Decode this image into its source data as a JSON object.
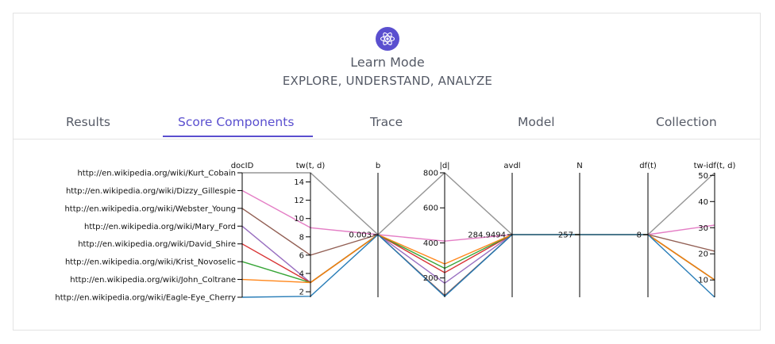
{
  "header": {
    "logo_icon": "atom-icon",
    "title": "Learn Mode",
    "subtitle": "EXPLORE, UNDERSTAND, ANALYZE"
  },
  "tabs": [
    {
      "label": "Results",
      "active": false
    },
    {
      "label": "Score Components",
      "active": true
    },
    {
      "label": "Trace",
      "active": false
    },
    {
      "label": "Model",
      "active": false
    },
    {
      "label": "Collection",
      "active": false
    }
  ],
  "colors": {
    "accent": "#5a4fcf",
    "text": "#555a66"
  },
  "chart_data": {
    "type": "parallel-coordinates",
    "axes": [
      {
        "key": "docID",
        "label": "docID",
        "kind": "categorical"
      },
      {
        "key": "tw",
        "label": "tw(t, d)",
        "domain": [
          1.4,
          15
        ],
        "ticks": [
          2,
          4,
          6,
          8,
          10,
          12,
          14
        ]
      },
      {
        "key": "b",
        "label": "b",
        "single_value": "0.003"
      },
      {
        "key": "d",
        "label": "|d|",
        "domain": [
          90,
          800
        ],
        "ticks": [
          200,
          400,
          600,
          800
        ]
      },
      {
        "key": "avdl",
        "label": "avdl",
        "single_value": "284.9494"
      },
      {
        "key": "N",
        "label": "N",
        "single_value": "257"
      },
      {
        "key": "df",
        "label": "df(t)",
        "single_value": "8"
      },
      {
        "key": "twidf",
        "label": "tw-idf(t, d)",
        "domain": [
          3.4,
          51
        ],
        "ticks": [
          10,
          20,
          30,
          40,
          50
        ]
      }
    ],
    "series": [
      {
        "name": "http://en.wikipedia.org/wiki/Kurt_Cobain",
        "color": "#8f8f8f",
        "tw": 15,
        "d": 800,
        "twidf": 51
      },
      {
        "name": "http://en.wikipedia.org/wiki/Dizzy_Gillespie",
        "color": "#e377c2",
        "tw": 9,
        "d": 410,
        "twidf": 31
      },
      {
        "name": "http://en.wikipedia.org/wiki/Webster_Young",
        "color": "#8c564b",
        "tw": 6,
        "d": 100,
        "twidf": 21
      },
      {
        "name": "http://en.wikipedia.org/wiki/Mary_Ford",
        "color": "#9467bd",
        "tw": 3,
        "d": 170,
        "twidf": 10
      },
      {
        "name": "http://en.wikipedia.org/wiki/David_Shire",
        "color": "#d62728",
        "tw": 3,
        "d": 230,
        "twidf": 10
      },
      {
        "name": "http://en.wikipedia.org/wiki/Krist_Novoselic",
        "color": "#2ca02c",
        "tw": 3,
        "d": 255,
        "twidf": 10
      },
      {
        "name": "http://en.wikipedia.org/wiki/John_Coltrane",
        "color": "#ff7f0e",
        "tw": 3,
        "d": 280,
        "twidf": 10
      },
      {
        "name": "http://en.wikipedia.org/wiki/Eagle-Eye_Cherry",
        "color": "#1f77b4",
        "tw": 1.5,
        "d": 95,
        "twidf": 3.4
      }
    ]
  }
}
